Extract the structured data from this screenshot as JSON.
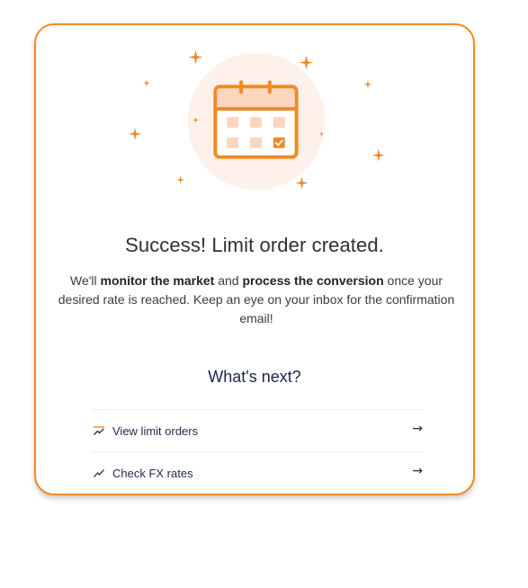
{
  "success": {
    "title": "Success! Limit order created.",
    "message_pre": "We'll ",
    "message_bold_1": "monitor the market",
    "message_mid": " and ",
    "message_bold_2": "process the conversion",
    "message_post": " once your desired rate is reached. Keep an eye on your inbox for the confirmation email!",
    "illustration_icon": "calendar-check-icon"
  },
  "next": {
    "heading": "What's next?",
    "actions": [
      {
        "label": "View limit orders",
        "icon": "limit-chart-icon",
        "arrow": "→"
      },
      {
        "label": "Check FX rates",
        "icon": "trend-line-icon",
        "arrow": "→"
      }
    ]
  },
  "colors": {
    "accent": "#f08a24",
    "accent_light": "#fbd6bf",
    "circle_bg": "#fdf1ea",
    "text_dark": "#2f2f35",
    "navy": "#1f2a4a"
  }
}
